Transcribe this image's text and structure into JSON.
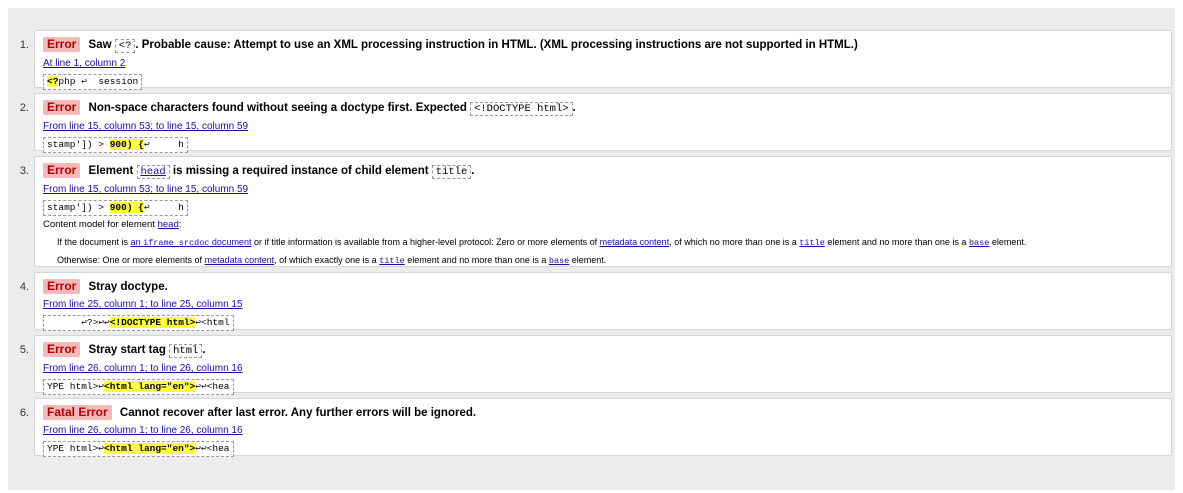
{
  "messages": [
    {
      "number": "1.",
      "type": "Error",
      "text_before": "Saw",
      "code": "<?",
      "text_after": ". Probable cause: Attempt to use an XML processing instruction in HTML. (XML processing instructions are not supported in HTML.)",
      "location": "At line 1, column 2",
      "extract_pre": "",
      "extract_hl": "<?",
      "extract_post": "php ↩  session"
    },
    {
      "number": "2.",
      "type": "Error",
      "text_before": "Non-space characters found without seeing a doctype first. Expected",
      "code": "<!DOCTYPE html>",
      "text_after": ".",
      "location": "From line 15, column 53; to line 15, column 59",
      "extract_pre": "stamp']) > ",
      "extract_hl": "900) {",
      "extract_post": "↩     h"
    },
    {
      "number": "3.",
      "type": "Error",
      "text_before": "Element",
      "link_code": "head",
      "text_mid": "is missing a required instance of child element",
      "code": "title",
      "text_after": ".",
      "location": "From line 15, column 53; to line 15, column 59",
      "extract_pre": "stamp']) > ",
      "extract_hl": "900) {",
      "extract_post": "↩     h",
      "content_model": {
        "label": "Content model for element",
        "element": "head",
        "colon": ":",
        "line1": {
          "t1": "If the document is",
          "l1": "an",
          "l1_code": "iframe srcdoc",
          "l1_tail": "document",
          "t2": "or if title information is available from a higher-level protocol: Zero or more elements of",
          "l2": "metadata content",
          "t3": ", of which no more than one is a",
          "c1": "title",
          "t4": "element and no more than one is a",
          "c2": "base",
          "t5": "element."
        },
        "line2": {
          "t1": "Otherwise: One or more elements of",
          "l1": "metadata content",
          "t2": ", of which exactly one is a",
          "c1": "title",
          "t3": "element and no more than one is a",
          "c2": "base",
          "t4": "element."
        }
      }
    },
    {
      "number": "4.",
      "type": "Error",
      "text_before": "Stray doctype.",
      "location": "From line 25, column 1; to line 25, column 15",
      "extract_pre": "      ↩?>↩↩",
      "extract_hl": "<!DOCTYPE html>",
      "extract_post": "↩<html"
    },
    {
      "number": "5.",
      "type": "Error",
      "text_before": "Stray start tag",
      "code": "html",
      "text_after": ".",
      "location": "From line 26, column 1; to line 26, column 16",
      "extract_pre": "YPE html>↩",
      "extract_hl": "<html lang=\"en\">",
      "extract_post": "↩↩<hea"
    },
    {
      "number": "6.",
      "type": "Fatal Error",
      "text_before": "Cannot recover after last error. Any further errors will be ignored.",
      "location": "From line 26, column 1; to line 26, column 16",
      "extract_pre": "YPE html>↩",
      "extract_hl": "<html lang=\"en\">",
      "extract_post": "↩↩<hea"
    }
  ]
}
